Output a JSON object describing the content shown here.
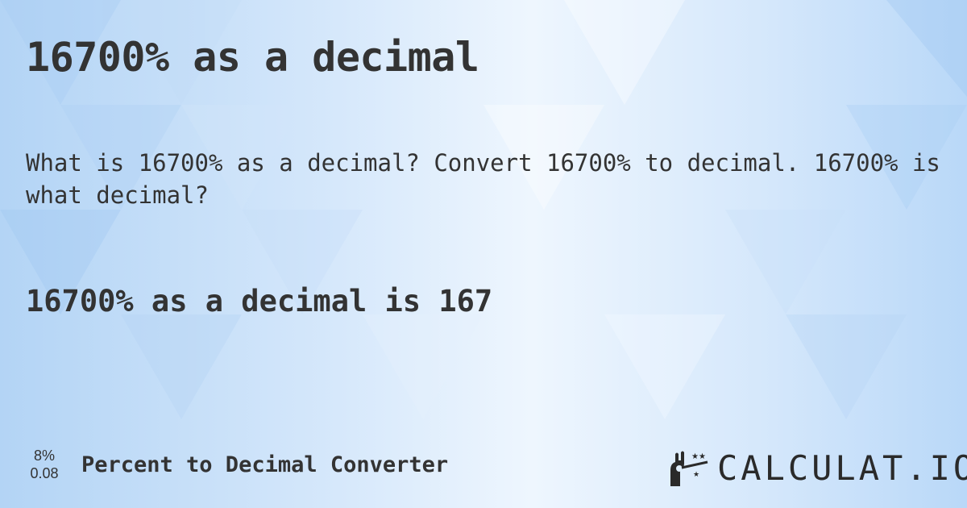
{
  "title": "16700% as a decimal",
  "description": "What is 16700% as a decimal? Convert 16700% to decimal. 16700% is what decimal?",
  "answer": "16700% as a decimal is 167",
  "footer": {
    "icon_top": "8%",
    "icon_bottom": "0.08",
    "label": "Percent to Decimal Converter"
  },
  "logo": {
    "text": "CALCULAT.IO",
    "icon": "magic-wand-hand-icon"
  },
  "colors": {
    "text": "#333333",
    "background_light": "#eef6fe",
    "background_dark": "#b3d4f5"
  }
}
